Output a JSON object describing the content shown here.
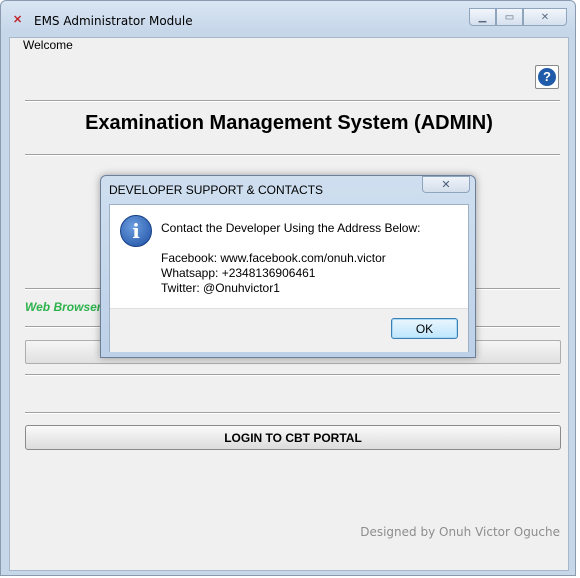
{
  "window": {
    "title": "EMS Administrator Module",
    "icon": "app-logo-icon",
    "controls": {
      "minimize": "minimize-icon",
      "maximize": "maximize-icon",
      "close": "close-icon"
    }
  },
  "main": {
    "tab_label": "Welcome",
    "help_icon": "help-icon",
    "title": "Examination Management System (ADMIN)",
    "web_browser_label": "Web Browser",
    "login_button": "LOGIN TO CBT PORTAL",
    "designed_by": "Designed by Onuh Victor Oguche"
  },
  "dialog": {
    "title": "DEVELOPER SUPPORT & CONTACTS",
    "icon": "info-icon",
    "lines": [
      "Contact the Developer Using the Address Below:",
      "",
      "Facebook: www.facebook.com/onuh.victor",
      "Whatsapp: +2348136906461",
      "Twitter: @Onuhvictor1"
    ],
    "ok_button": "OK"
  },
  "colors": {
    "accent": "#2db24c",
    "title_bar": "#c7d7ea",
    "info_blue": "#1c4fa3"
  }
}
